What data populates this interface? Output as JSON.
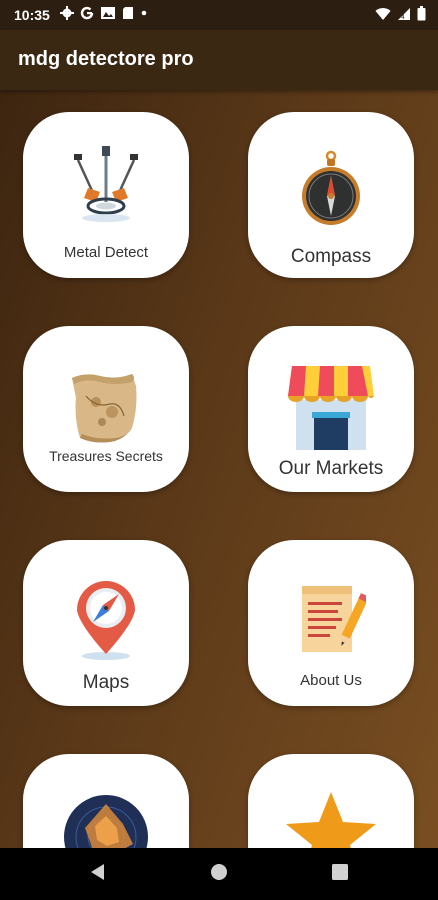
{
  "status": {
    "time": "10:35"
  },
  "app": {
    "title": "mdg detectore pro"
  },
  "tiles": [
    {
      "label": "Metal Detect"
    },
    {
      "label": "Compass"
    },
    {
      "label": "Treasures Secrets"
    },
    {
      "label": "Our Markets"
    },
    {
      "label": "Maps"
    },
    {
      "label": "About Us"
    },
    {
      "label": ""
    },
    {
      "label": ""
    }
  ],
  "colors": {
    "status_bar": "#2c1f12",
    "app_bar": "#3a2813",
    "background_start": "#3a230f",
    "background_end": "#7a4f22",
    "nav_bar": "#000000"
  }
}
